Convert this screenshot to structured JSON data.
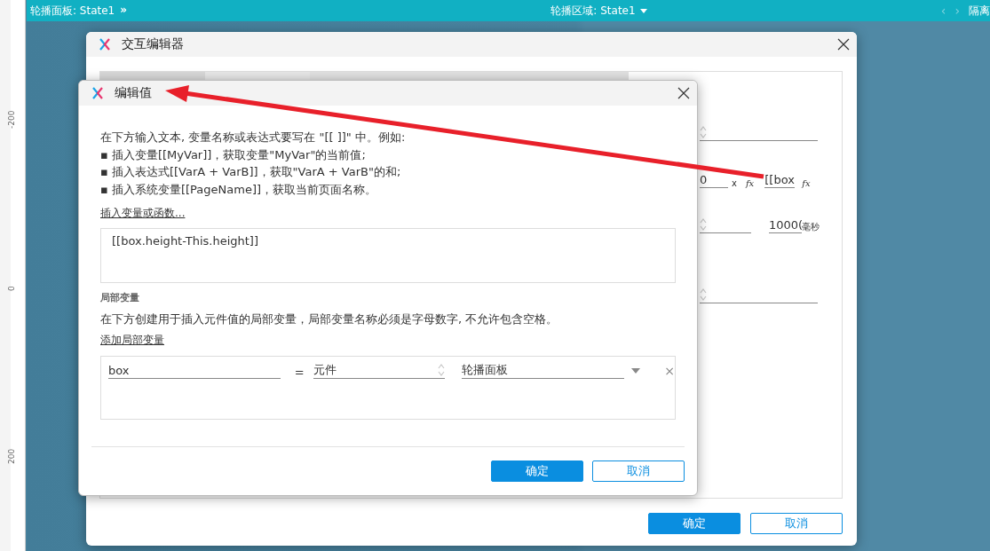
{
  "top_bar": {
    "left_label": "轮播面板: State1",
    "left_icon": "»",
    "center_label": "轮播区域: State1",
    "nav_prev": "‹",
    "nav_next": "›",
    "right_label": "隔离"
  },
  "ruler": {
    "labels": [
      "-200",
      "0",
      "200"
    ]
  },
  "interaction_editor": {
    "title": "交互编辑器",
    "rows": [
      {
        "kind": "select"
      },
      {
        "kind": "offset",
        "value": "0",
        "unit": "x",
        "function": "fx",
        "expression": "[[box",
        "expression_function": "fx"
      },
      {
        "kind": "duration",
        "value": "1000(",
        "unit": "毫秒"
      },
      {
        "kind": "select"
      }
    ],
    "buttons": [
      {
        "label": "确定",
        "kind": "primary"
      },
      {
        "label": "取消",
        "kind": "secondary"
      }
    ]
  },
  "edit_value": {
    "title": "编辑值",
    "instructions": [
      "在下方输入文本, 变量名称或表达式要写在 \"[[ ]]\" 中。例如:",
      "▪ 插入变量[[MyVar]]，获取变量\"MyVar\"的当前值;",
      "▪ 插入表达式[[VarA + VarB]]，获取\"VarA + VarB\"的和;",
      "▪ 插入系统变量[[PageName]]，获取当前页面名称。"
    ],
    "insert_link": "插入变量或函数...",
    "expression": "[[box.height-This.height]]",
    "local_section_label": "局部变量",
    "local_description": "在下方创建用于插入元件值的局部变量，局部变量名称必须是字母数字, 不允许包含空格。",
    "add_local_link": "添加局部变量",
    "local_variables": [
      {
        "name": "box",
        "operator": "=",
        "type": "元件",
        "target": "轮播面板",
        "remove": "×"
      }
    ],
    "buttons": [
      {
        "label": "确定",
        "kind": "primary"
      },
      {
        "label": "取消",
        "kind": "secondary"
      }
    ]
  },
  "annotation": {
    "kind": "arrow"
  }
}
